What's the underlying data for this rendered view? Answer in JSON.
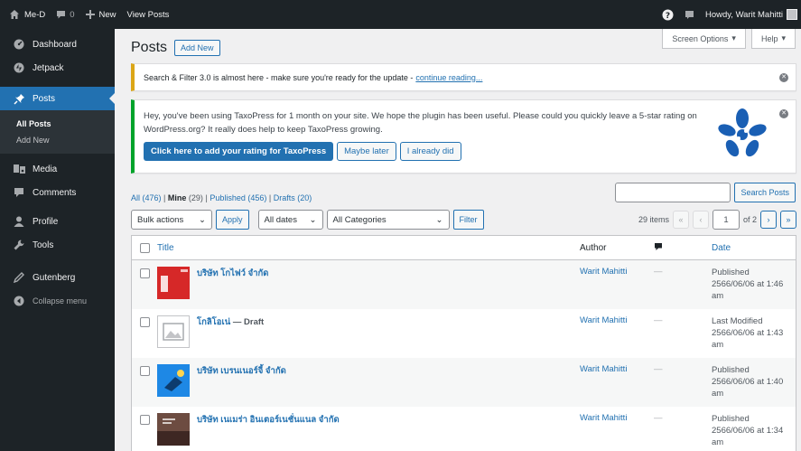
{
  "adminbar": {
    "site_name": "Me-D",
    "comment_count": "0",
    "new_label": "New",
    "view_posts": "View Posts",
    "howdy": "Howdy, Warit Mahitti"
  },
  "sidebar": {
    "items": [
      {
        "label": "Dashboard",
        "icon": "dashboard-icon"
      },
      {
        "label": "Jetpack",
        "icon": "jetpack-icon"
      },
      {
        "label": "Posts",
        "icon": "pin-icon"
      },
      {
        "label": "Media",
        "icon": "media-icon"
      },
      {
        "label": "Comments",
        "icon": "comment-icon"
      },
      {
        "label": "Profile",
        "icon": "user-icon"
      },
      {
        "label": "Tools",
        "icon": "wrench-icon"
      },
      {
        "label": "Gutenberg",
        "icon": "pen-icon"
      }
    ],
    "submenu": [
      "All Posts",
      "Add New"
    ],
    "collapse": "Collapse menu"
  },
  "screen_options": "Screen Options",
  "help": "Help",
  "page": {
    "title": "Posts",
    "add_new": "Add New"
  },
  "notice1": {
    "text": "Search & Filter 3.0 is almost here - make sure you're ready for the update -",
    "link": "continue reading..."
  },
  "notice2": {
    "text": "Hey, you've been using TaxoPress for 1 month on your site. We hope the plugin has been useful. Please could you quickly leave a 5-star rating on WordPress.org? It really does help to keep TaxoPress growing.",
    "btn_rate": "Click here to add your rating for TaxoPress",
    "btn_later": "Maybe later",
    "btn_done": "I already did"
  },
  "views": {
    "all": "All (476)",
    "mine_label": "Mine",
    "mine_count": "(29)",
    "published": "Published (456)",
    "drafts": "Drafts (20)"
  },
  "search": {
    "button": "Search Posts"
  },
  "tablenav": {
    "bulk_actions": "Bulk actions",
    "apply": "Apply",
    "all_dates": "All dates",
    "all_categories": "All Categories",
    "filter": "Filter",
    "items": "29 items",
    "current_page": "1",
    "of_pages": "of 2"
  },
  "table": {
    "headers": {
      "title": "Title",
      "author": "Author",
      "date": "Date"
    },
    "rows": [
      {
        "title": "บริษัท โกไฟว์ จำกัด",
        "state": "",
        "author": "Warit Mahitti",
        "comments": "—",
        "status": "Published",
        "date": "2566/06/06 at 1:46 am",
        "thumb": "red"
      },
      {
        "title": "โกลิโอเน่",
        "state": "— Draft",
        "author": "Warit Mahitti",
        "comments": "—",
        "status": "Last Modified",
        "date": "2566/06/06 at 1:43 am",
        "thumb": "placeholder"
      },
      {
        "title": "บริษัท เบรนเนอร์จี้ จำกัด",
        "state": "",
        "author": "Warit Mahitti",
        "comments": "—",
        "status": "Published",
        "date": "2566/06/06 at 1:40 am",
        "thumb": "blue"
      },
      {
        "title": "บริษัท เนเมร่า อินเตอร์เนชั่นแนล จำกัด",
        "state": "",
        "author": "Warit Mahitti",
        "comments": "—",
        "status": "Published",
        "date": "2566/06/06 at 1:34 am",
        "thumb": "brown"
      }
    ]
  },
  "colors": {
    "accent": "#2271b1",
    "adminbar": "#1d2327",
    "notice_warning": "#dba617",
    "notice_success": "#00a32a"
  }
}
